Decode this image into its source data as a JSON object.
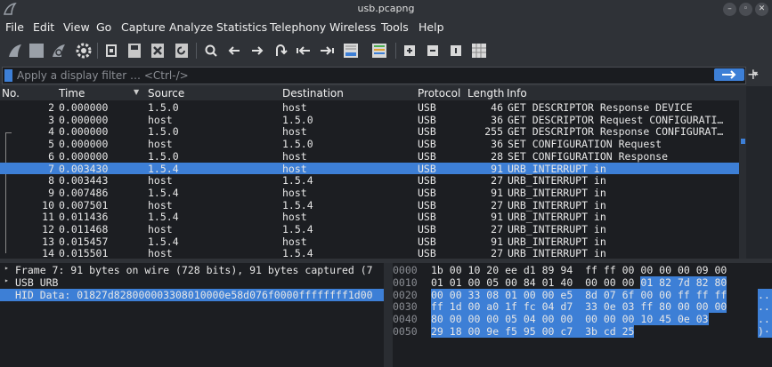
{
  "window": {
    "title": "usb.pcapng"
  },
  "menu": [
    "File",
    "Edit",
    "View",
    "Go",
    "Capture",
    "Analyze",
    "Statistics",
    "Telephony",
    "Wireless",
    "Tools",
    "Help"
  ],
  "toolbar": {
    "icons": [
      "shark-fin-start-icon",
      "stop-square-icon",
      "restart-fin-icon",
      "options-gear-icon",
      "open-file-icon",
      "save-file-icon",
      "close-file-icon",
      "reload-icon",
      "find-icon",
      "go-back-icon",
      "go-forward-icon",
      "go-to-packet-icon",
      "go-first-icon",
      "go-last-icon",
      "autoscroll-icon",
      "colorize-icon",
      "zoom-in-icon",
      "zoom-out-icon",
      "normal-size-icon",
      "resize-columns-icon"
    ]
  },
  "filter": {
    "placeholder": "Apply a display filter … <Ctrl-/>"
  },
  "columns": {
    "no": "No.",
    "time": "Time",
    "source": "Source",
    "destination": "Destination",
    "protocol": "Protocol",
    "length": "Length",
    "info": "Info"
  },
  "packets": [
    {
      "no": "2",
      "time": "0.000000",
      "src": "1.5.0",
      "dst": "host",
      "proto": "USB",
      "len": "46",
      "info": "GET DESCRIPTOR Response DEVICE"
    },
    {
      "no": "3",
      "time": "0.000000",
      "src": "host",
      "dst": "1.5.0",
      "proto": "USB",
      "len": "36",
      "info": "GET DESCRIPTOR Request CONFIGURATI…"
    },
    {
      "no": "4",
      "time": "0.000000",
      "src": "1.5.0",
      "dst": "host",
      "proto": "USB",
      "len": "255",
      "info": "GET DESCRIPTOR Response CONFIGURAT…"
    },
    {
      "no": "5",
      "time": "0.000000",
      "src": "host",
      "dst": "1.5.0",
      "proto": "USB",
      "len": "36",
      "info": "SET CONFIGURATION Request"
    },
    {
      "no": "6",
      "time": "0.000000",
      "src": "1.5.0",
      "dst": "host",
      "proto": "USB",
      "len": "28",
      "info": "SET CONFIGURATION Response"
    },
    {
      "no": "7",
      "time": "0.003430",
      "src": "1.5.4",
      "dst": "host",
      "proto": "USB",
      "len": "91",
      "info": "URB_INTERRUPT in",
      "selected": true
    },
    {
      "no": "8",
      "time": "0.003443",
      "src": "host",
      "dst": "1.5.4",
      "proto": "USB",
      "len": "27",
      "info": "URB_INTERRUPT in"
    },
    {
      "no": "9",
      "time": "0.007486",
      "src": "1.5.4",
      "dst": "host",
      "proto": "USB",
      "len": "91",
      "info": "URB_INTERRUPT in"
    },
    {
      "no": "10",
      "time": "0.007501",
      "src": "host",
      "dst": "1.5.4",
      "proto": "USB",
      "len": "27",
      "info": "URB_INTERRUPT in"
    },
    {
      "no": "11",
      "time": "0.011436",
      "src": "1.5.4",
      "dst": "host",
      "proto": "USB",
      "len": "91",
      "info": "URB_INTERRUPT in"
    },
    {
      "no": "12",
      "time": "0.011468",
      "src": "host",
      "dst": "1.5.4",
      "proto": "USB",
      "len": "27",
      "info": "URB_INTERRUPT in"
    },
    {
      "no": "13",
      "time": "0.015457",
      "src": "1.5.4",
      "dst": "host",
      "proto": "USB",
      "len": "91",
      "info": "URB_INTERRUPT in"
    },
    {
      "no": "14",
      "time": "0.015501",
      "src": "host",
      "dst": "1.5.4",
      "proto": "USB",
      "len": "27",
      "info": "URB_INTERRUPT in"
    }
  ],
  "details": [
    {
      "text": "Frame 7: 91 bytes on wire (728 bits), 91 bytes captured (7",
      "expander": "collapsed"
    },
    {
      "text": "USB URB",
      "expander": "collapsed"
    },
    {
      "text": "HID Data: 01827d828000003308010000e58d076f0000ffffffff1d00",
      "expander": "none",
      "selected": true
    }
  ],
  "hex": [
    {
      "offset": "0000",
      "plain": "1b 00 10 20 ee d1 89 94  ff ff 00 00 00 00 09 00",
      "highlight": "",
      "ascii": ""
    },
    {
      "offset": "0010",
      "plain": "01 01 00 05 00 84 01 40  00 00 00 ",
      "highlight": "01 82 7d 82 80",
      "ascii": ""
    },
    {
      "offset": "0020",
      "plain": "",
      "highlight": "00 00 33 08 01 00 00 e5  8d 07 6f 00 00 ff ff ff",
      "ascii": ".."
    },
    {
      "offset": "0030",
      "plain": "",
      "highlight": "ff 1d 00 a0 1f fc 04 d7  33 0e 03 ff 80 00 00 00",
      "ascii": ".."
    },
    {
      "offset": "0040",
      "plain": "",
      "highlight": "80 00 00 00 05 04 00 00  00 00 00 10 45 0e 03",
      "ascii": ".."
    },
    {
      "offset": "0050",
      "plain": "",
      "highlight": "29 18 00 9e f5 95 00 c7  3b cd 25",
      "ascii": ")·"
    }
  ],
  "colors": {
    "selection": "#3d7fd6",
    "background": "#1c1e22",
    "chrome": "#2f3237"
  }
}
